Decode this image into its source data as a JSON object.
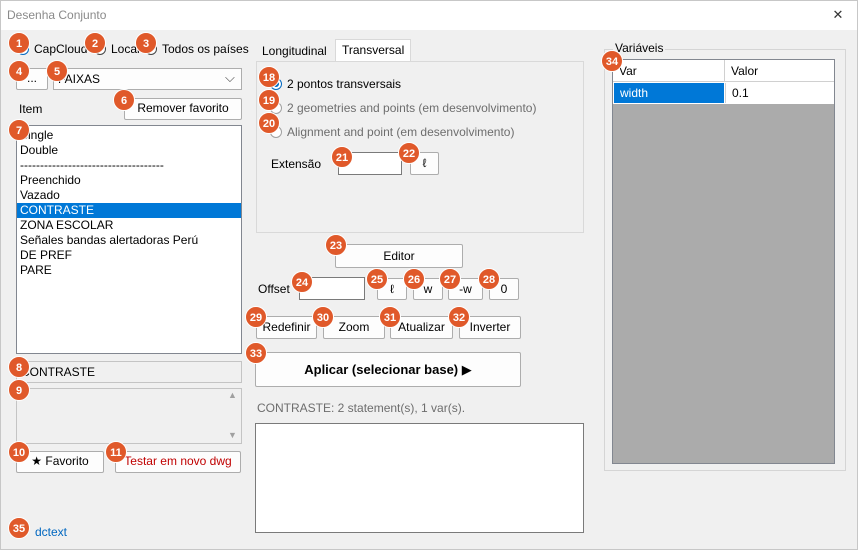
{
  "window": {
    "title": "Desenha Conjunto",
    "close_glyph": "✕"
  },
  "source": {
    "options": [
      "CapCloud",
      "Local",
      "Todos os países"
    ],
    "selected": "CapCloud"
  },
  "toolbar": {
    "browse_label": "...",
    "dropdown_value": "FAIXAS"
  },
  "item": {
    "label": "Item",
    "remove_favorite_label": "Remover favorito",
    "list": [
      "Single",
      "Double",
      "------------------------------------",
      "Preenchido",
      "Vazado",
      "CONTRASTE",
      "ZONA ESCOLAR",
      "Señales bandas alertadoras Perú",
      "DE PREF",
      "PARE"
    ],
    "selected": "CONTRASTE",
    "selected_name": "CONTRASTE",
    "favorite_label": "★ Favorito",
    "test_label": "Testar em novo dwg"
  },
  "tabs": {
    "longitudinal": "Longitudinal",
    "transversal": "Transversal",
    "active": "Transversal"
  },
  "transversal": {
    "options": [
      "2 pontos transversais",
      "2 geometries and points (em desenvolvimento)",
      "Alignment and point (em desenvolvimento)"
    ],
    "selected": "2 pontos transversais",
    "extensao_label": "Extensão",
    "extensao_value": "",
    "ell_label": "ℓ"
  },
  "editor_label": "Editor",
  "offset": {
    "label": "Offset",
    "value": "",
    "ell": "ℓ",
    "w": "w",
    "neg_w": "-w",
    "zero": "0"
  },
  "actions": {
    "redefinir": "Redefinir",
    "zoom": "Zoom",
    "atualizar": "Atualizar",
    "inverter": "Inverter"
  },
  "apply_label": "Aplicar (selecionar base) ▶",
  "status_text": "CONTRASTE: 2 statement(s), 1 var(s).",
  "variables": {
    "group_label": "Variáveis",
    "columns": [
      "Var",
      "Valor"
    ],
    "rows": [
      {
        "var": "width",
        "valor": "0.1"
      }
    ]
  },
  "footer_link": "dctext",
  "badges": [
    "1",
    "2",
    "3",
    "4",
    "5",
    "6",
    "7",
    "8",
    "9",
    "10",
    "11",
    "18",
    "19",
    "20",
    "21",
    "22",
    "23",
    "24",
    "25",
    "26",
    "27",
    "28",
    "29",
    "30",
    "31",
    "32",
    "33",
    "34",
    "35"
  ],
  "colors": {
    "badge": "#e0592a",
    "accent": "#0078d7",
    "link": "#0067c0",
    "danger_text": "#c00000"
  }
}
